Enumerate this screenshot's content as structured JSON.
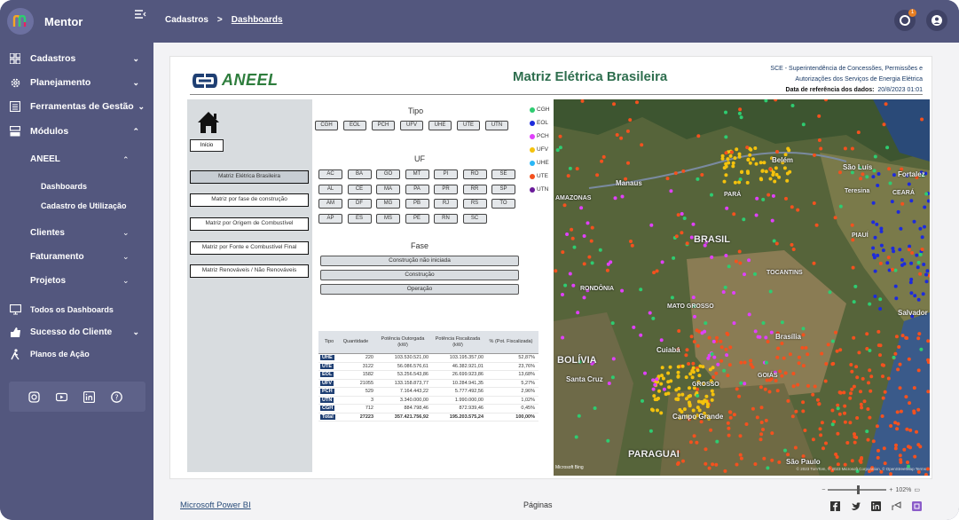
{
  "app": {
    "name": "Mentor"
  },
  "sidebar": {
    "items": [
      {
        "label": "Cadastros",
        "icon": "grid-icon"
      },
      {
        "label": "Planejamento",
        "icon": "gear-icon"
      },
      {
        "label": "Ferramentas de Gestão",
        "icon": "list-icon"
      },
      {
        "label": "Módulos",
        "icon": "modules-icon"
      }
    ],
    "aneel": "ANEEL",
    "aneel_sub": [
      "Dashboards",
      "Cadastro de Utilização"
    ],
    "modules": [
      "Clientes",
      "Faturamento",
      "Projetos"
    ],
    "bottom": [
      {
        "label": "Todos os Dashboards",
        "icon": "monitor-icon"
      },
      {
        "label": "Sucesso do Cliente",
        "icon": "thumbs-up-icon"
      },
      {
        "label": "Planos de Ação",
        "icon": "running-icon"
      }
    ],
    "social": [
      "instagram-icon",
      "youtube-icon",
      "linkedin-icon",
      "help-icon"
    ]
  },
  "topbar": {
    "breadcrumb_root": "Cadastros",
    "breadcrumb_sep": ">",
    "breadcrumb_current": "Dashboards",
    "notification_count": "1"
  },
  "report": {
    "logo_text": "ANEEL",
    "title": "Matriz Elétrica Brasileira",
    "sce_line1": "SCE - Superintendência de Concessões, Permissões e",
    "sce_line2": "Autorizações dos Serviços de Energia Elétrica",
    "ref_label": "Data de referência dos dados:",
    "ref_value": "20/8/2023 01:01",
    "inicio": "Início",
    "nav": [
      "Matriz Elétrica Brasileira",
      "Matriz por fase de construção",
      "Matriz por Origem de Combustível",
      "Matriz por Fonte e Combustível Final",
      "Matriz Renováveis / Não Renováveis"
    ],
    "tipo_label": "Tipo",
    "tipo": [
      "CGH",
      "EOL",
      "PCH",
      "UFV",
      "UHE",
      "UTE",
      "UTN"
    ],
    "uf_label": "UF",
    "uf": [
      "AC",
      "BA",
      "GO",
      "MT",
      "PI",
      "RO",
      "SE",
      "AL",
      "CE",
      "MA",
      "PA",
      "PR",
      "RR",
      "SP",
      "AM",
      "DF",
      "MG",
      "PB",
      "RJ",
      "RS",
      "TO",
      "AP",
      "ES",
      "MS",
      "PE",
      "RN",
      "SC"
    ],
    "fase_label": "Fase",
    "fase": [
      "Construção não iniciada",
      "Construção",
      "Operação"
    ],
    "legend": [
      {
        "label": "CGH",
        "color": "#2ecc71"
      },
      {
        "label": "EOL",
        "color": "#1d2bdc"
      },
      {
        "label": "PCH",
        "color": "#e040fb"
      },
      {
        "label": "UFV",
        "color": "#f4c20d"
      },
      {
        "label": "UHE",
        "color": "#29b6f6"
      },
      {
        "label": "UTE",
        "color": "#f4511e"
      },
      {
        "label": "UTN",
        "color": "#6a1b9a"
      }
    ],
    "table": {
      "headers": [
        "Tipo",
        "Quantidade",
        "Potência Outorgada (kW)",
        "Potência Fiscalizada (kW)",
        "% (Pot. Fiscalizada)"
      ],
      "rows": [
        [
          "UHE",
          "220",
          "103.530.521,00",
          "103.195.357,00",
          "52,87%"
        ],
        [
          "UTE",
          "3122",
          "56.086.576,61",
          "46.382.921,01",
          "23,76%"
        ],
        [
          "EOL",
          "1582",
          "53.256.543,86",
          "26.699.923,86",
          "13,68%"
        ],
        [
          "UFV",
          "21055",
          "133.158.873,77",
          "10.284.941,35",
          "5,27%"
        ],
        [
          "PCH",
          "529",
          "7.164.443,22",
          "5.777.492,56",
          "2,96%"
        ],
        [
          "UTN",
          "3",
          "3.340.000,00",
          "1.990.000,00",
          "1,02%"
        ],
        [
          "CGH",
          "712",
          "884.798,46",
          "872.939,46",
          "0,45%"
        ]
      ],
      "total": [
        "Total",
        "27223",
        "357.421.756,92",
        "195.203.575,24",
        "100,00%"
      ]
    },
    "map_labels": {
      "brasil": "BRASIL",
      "bolivia": "BOLÍVIA",
      "paraguai": "PARAGUAI",
      "belem": "Belém",
      "manaus": "Manaus",
      "para": "PARÁ",
      "amazonas": "AMAZONAS",
      "mato_grosso": "MATO GROSSO",
      "cuiaba": "Cuiabá",
      "brasilia": "Brasília",
      "santa_cruz": "Santa Cruz",
      "campo_grande": "Campo Grande",
      "sao_paulo": "São Paulo",
      "salvador": "Salvador",
      "tocantins": "TOCANTINS",
      "rondonia": "RONDÔNIA",
      "fortaleza": "Fortalez",
      "teresina": "Teresina",
      "ceara": "CEARÁ",
      "piaui": "PIAUÍ",
      "sao_luis": "São Luís",
      "goias": "GOIÁS",
      "grosso_sul": "GROSSO",
      "attribution": "© 2023 TomTom, © 2023 Microsoft Corporation, © OpenStreetMap  Terms",
      "bing": "Microsoft Bing"
    }
  },
  "footer": {
    "powerbi": "Microsoft Power BI",
    "paginas": "Páginas",
    "zoom": "102%"
  }
}
